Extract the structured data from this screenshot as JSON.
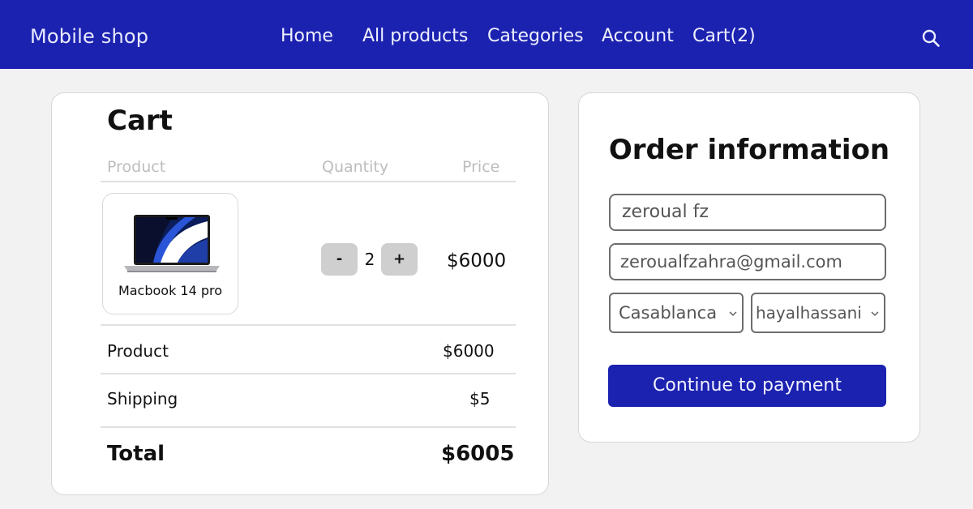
{
  "header": {
    "brand": "Mobile shop",
    "nav": {
      "home": "Home",
      "all_products": "All products",
      "categories": "Categories",
      "account": "Account",
      "cart": "Cart(2)"
    },
    "search_icon": "search-icon",
    "background": "#1c22b0"
  },
  "cart": {
    "title": "Cart",
    "columns": {
      "product": "Product",
      "quantity": "Quantity",
      "price": "Price"
    },
    "items": [
      {
        "name": "Macbook 14 pro",
        "image_icon": "laptop-image",
        "quantity": "2",
        "minus_label": "-",
        "plus_label": "+",
        "price": "$6000"
      }
    ],
    "summary": {
      "product_label": "Product",
      "product_value": "$6000",
      "shipping_label": "Shipping",
      "shipping_value": "$5",
      "total_label": "Total",
      "total_value": "$6005"
    }
  },
  "order": {
    "title": "Order information",
    "name_value": "zeroual fz",
    "email_value": "zeroualfzahra@gmail.com",
    "city_selected": "Casablanca",
    "area_selected": "hayalhassani",
    "submit_label": "Continue to payment",
    "accent": "#1c22b0"
  }
}
